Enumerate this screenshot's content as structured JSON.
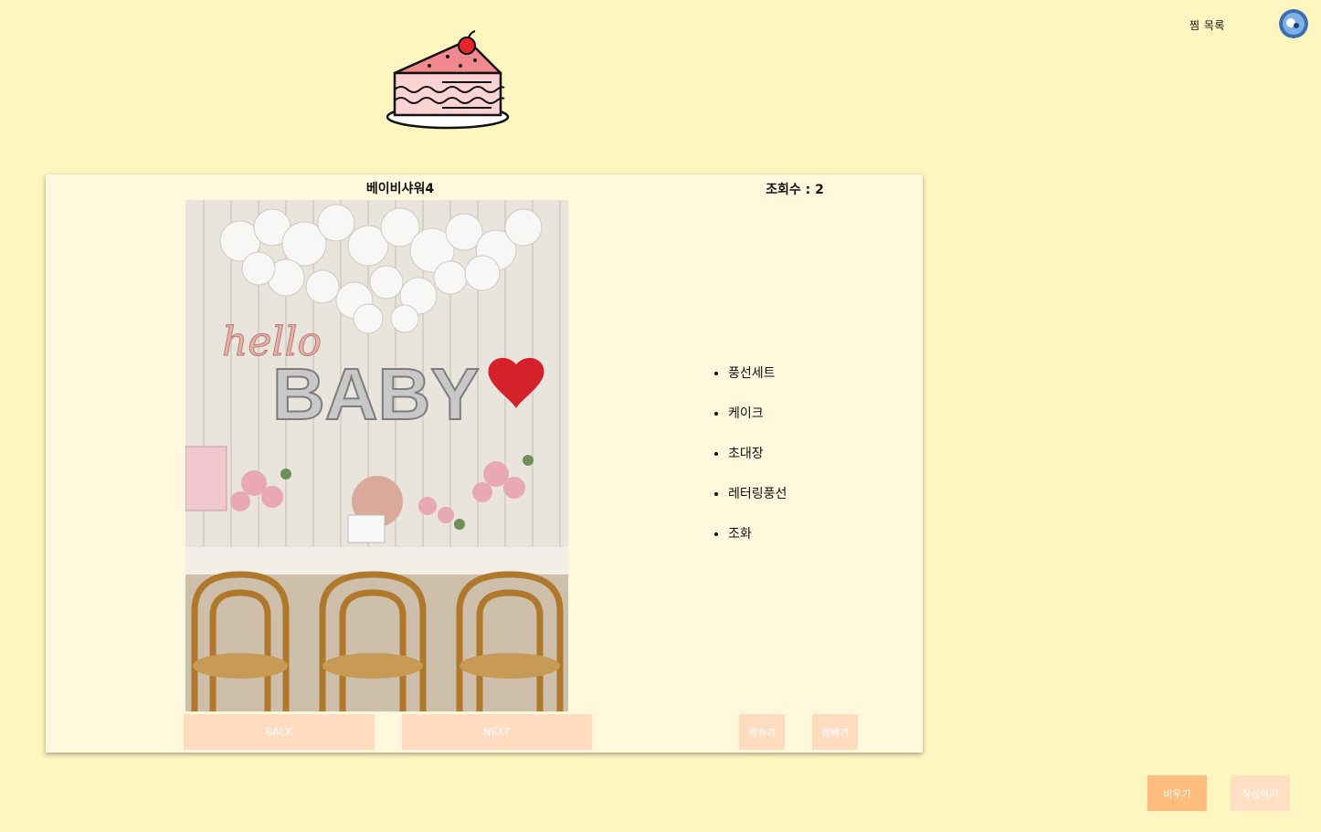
{
  "header": {
    "wishlist_label": "찜 목록"
  },
  "post": {
    "title": "베이비샤워4",
    "view_count": "조회수 : 2",
    "items": [
      "풍선세트",
      "케이크",
      "초대장",
      "레터링풍선",
      "조화"
    ],
    "photo_text": "BABY",
    "photo_script": "hello",
    "back_label": "BACK",
    "next_label": "NEXT",
    "wish_label": "찜하기",
    "unwish_label": "찜빼기"
  },
  "footer": {
    "clear_label": "비우기",
    "write_label": "작성하기"
  },
  "colors": {
    "background": "#fff5c0",
    "card": "#fff8dd",
    "button_light": "#ffdcc0",
    "button_accent": "#ffbc7c"
  }
}
